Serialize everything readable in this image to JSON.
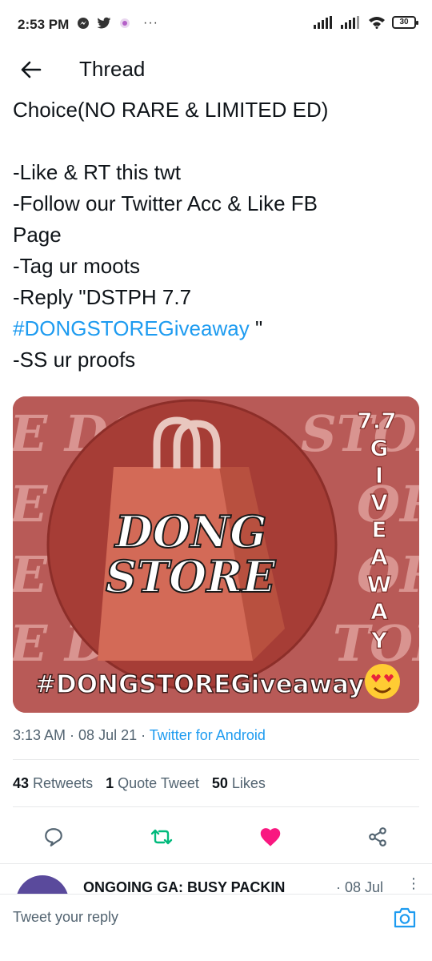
{
  "status_bar": {
    "time": "2:53 PM",
    "battery": "30",
    "more": "···"
  },
  "header": {
    "title": "Thread"
  },
  "tweet": {
    "lines": [
      "Choice(NO RARE & LIMITED ED)",
      "",
      "-Like & RT this twt",
      "-Follow our Twitter Acc & Like FB",
      "Page",
      "-Tag ur moots",
      "-Reply \"DSTPH 7.7"
    ],
    "hashtag": "#DONGSTOREGiveaway",
    "hashtag_suffix": " \"",
    "last_line": "-SS ur proofs"
  },
  "media": {
    "brand_top": "DONG",
    "brand_bottom": "STORE",
    "side_number": "7.7",
    "side_letters": [
      "G",
      "I",
      "V",
      "E",
      "A",
      "W",
      "A",
      "Y"
    ],
    "hashtag": "#DONGSTOREGiveaway",
    "bg_words": [
      "E DO",
      "STOR",
      "E",
      "OR",
      "E",
      "OR",
      "E D",
      "TOR"
    ]
  },
  "meta": {
    "time": "3:13 AM",
    "sep1": " · ",
    "date": "08 Jul 21",
    "sep2": " · ",
    "source": "Twitter for Android"
  },
  "stats": {
    "retweets_count": "43",
    "retweets_label": "Retweets",
    "quotes_count": "1",
    "quotes_label": "Quote Tweet",
    "likes_count": "50",
    "likes_label": "Likes"
  },
  "next_reply": {
    "name": "ONGOING GA: BUSY PACKIN",
    "date": "· 08 Jul",
    "more": "⋮"
  },
  "reply_bar": {
    "placeholder": "Tweet your reply"
  },
  "colors": {
    "accent": "#1d9bf0",
    "retweet_green": "#00ba7c",
    "like_pink": "#f91880",
    "media_bg": "#b85a57"
  }
}
